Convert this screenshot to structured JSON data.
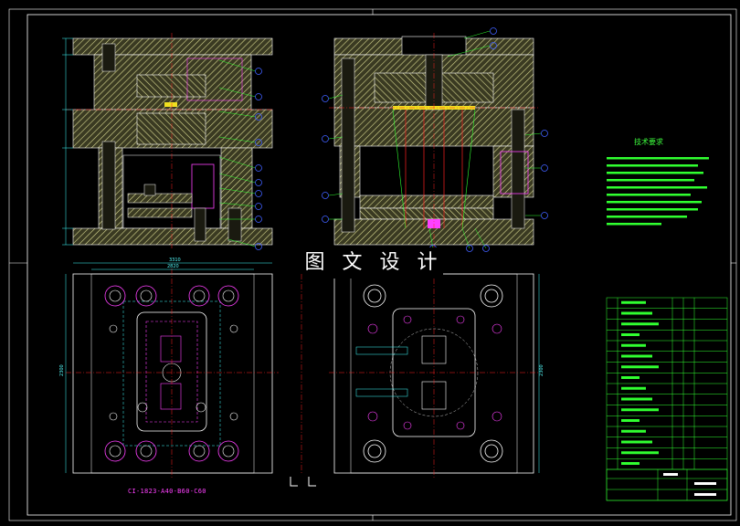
{
  "banner": {
    "text": "图 文 设 计"
  },
  "tech_requirements": {
    "title": "技术要求"
  },
  "model_code": "CI-1823-A40-B60-C60",
  "colors": {
    "background": "#000000",
    "outline": "#ffffff",
    "hatch": "#d8d890",
    "centerline": "#ff2020",
    "dimension": "#40ffff",
    "leader": "#30ff30",
    "balloon": "#4060ff",
    "magenta": "#ff40ff",
    "table": "#30ff30"
  },
  "dimensions": {
    "bottom_left_top_a": "3310",
    "bottom_left_top_b": "2820",
    "left_vertical_side": "2300",
    "right_vertical_side": "2300"
  }
}
